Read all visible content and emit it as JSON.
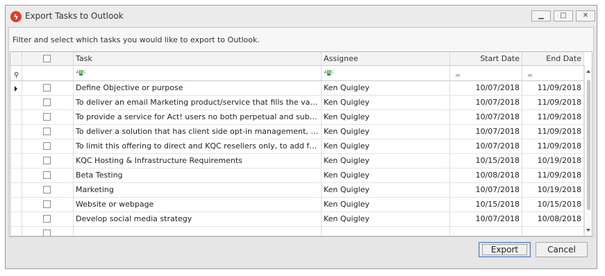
{
  "window": {
    "title": "Export Tasks to Outlook",
    "icon": "lightning-bolt-icon",
    "controls": [
      "minimize",
      "maximize",
      "close"
    ]
  },
  "instruction": "Filter and select which tasks you would like to export to Outlook.",
  "grid": {
    "columns": {
      "task": "Task",
      "assignee": "Assignee",
      "start_date": "Start Date",
      "end_date": "End Date"
    },
    "filter_icons": {
      "task": "abc-filter-icon",
      "assignee": "abc-filter-icon",
      "start_date": "equals-filter-icon",
      "end_date": "equals-filter-icon"
    },
    "rows": [
      {
        "task": "Define Objective or purpose",
        "assignee": "Ken Quigley",
        "start": "10/07/2018",
        "end": "11/09/2018"
      },
      {
        "task": "To deliver an email Marketing product/service that fills the vacuum left…",
        "assignee": "Ken Quigley",
        "start": "10/07/2018",
        "end": "11/09/2018"
      },
      {
        "task": "To provide a service for Act! users no both perpetual and subscription…",
        "assignee": "Ken Quigley",
        "start": "10/07/2018",
        "end": "11/09/2018"
      },
      {
        "task": "To deliver a solution that has client side opt-in management, suppressi…",
        "assignee": "Ken Quigley",
        "start": "10/07/2018",
        "end": "11/09/2018"
      },
      {
        "task": "To limit this offering to direct and KQC resellers only, to add further a…",
        "assignee": "Ken Quigley",
        "start": "10/07/2018",
        "end": "11/09/2018"
      },
      {
        "task": "KQC Hosting & Infrastructure Requirements",
        "assignee": "Ken Quigley",
        "start": "10/15/2018",
        "end": "10/19/2018"
      },
      {
        "task": "Beta Testing",
        "assignee": "Ken Quigley",
        "start": "10/08/2018",
        "end": "11/09/2018"
      },
      {
        "task": "Marketing",
        "assignee": "Ken Quigley",
        "start": "10/07/2018",
        "end": "10/19/2018"
      },
      {
        "task": "Website or webpage",
        "assignee": "Ken Quigley",
        "start": "10/15/2018",
        "end": "10/15/2018"
      },
      {
        "task": "Develop social media strategy",
        "assignee": "Ken Quigley",
        "start": "10/07/2018",
        "end": "10/08/2018"
      }
    ]
  },
  "buttons": {
    "export": "Export",
    "cancel": "Cancel"
  },
  "colors": {
    "window_bg": "#e6e6e6",
    "grid_border": "#b8b8b8",
    "primary_button_border": "#4d79b6",
    "app_icon": "#d8402a"
  }
}
